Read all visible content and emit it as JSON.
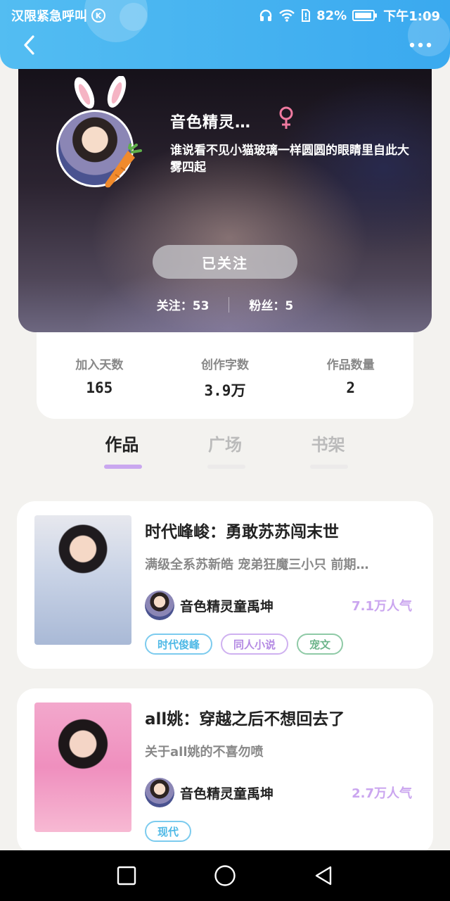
{
  "status_bar": {
    "carrier": "汉限紧急呼叫",
    "carrier_badge": "K",
    "battery": "82%",
    "time": "下午1:09"
  },
  "profile": {
    "username": "音色精灵…",
    "gender": "female",
    "bio": "谁说看不见小猫玻璃一样圆圆的眼睛里自此大雾四起",
    "follow_button": "已关注",
    "following": "关注：53",
    "fans": "粉丝：5"
  },
  "summary": [
    {
      "label": "加入天数",
      "value": "165"
    },
    {
      "label": "创作字数",
      "value": "3.9万"
    },
    {
      "label": "作品数量",
      "value": "2"
    }
  ],
  "tabs": [
    {
      "label": "作品",
      "active": true
    },
    {
      "label": "广场",
      "active": false
    },
    {
      "label": "书架",
      "active": false
    }
  ],
  "books": [
    {
      "title": "时代峰峻：勇敢苏苏闯末世",
      "description": "满级全系苏新皓 宠弟狂魔三小只 前期…",
      "author": "音色精灵童禹坤",
      "popularity": "7.1万人气",
      "tags": [
        "时代俊峰",
        "同人小说",
        "宠文"
      ]
    },
    {
      "title": "all姚：穿越之后不想回去了",
      "description": "关于all姚的不喜勿喷",
      "author": "音色精灵童禹坤",
      "popularity": "2.7万人气",
      "tags": [
        "现代"
      ]
    }
  ],
  "colors": {
    "header_blue": "#3aa9ef",
    "accent_purple": "#c9a7ef",
    "tag_blue": "#4fb9e6",
    "tag_purple": "#b48ae3",
    "tag_green": "#6cb48a"
  }
}
